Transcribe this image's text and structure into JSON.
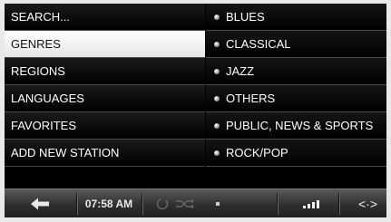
{
  "menu": {
    "items": [
      {
        "label": "SEARCH..."
      },
      {
        "label": "GENRES"
      },
      {
        "label": "REGIONS"
      },
      {
        "label": "LANGUAGES"
      },
      {
        "label": "FAVORITES"
      },
      {
        "label": "ADD NEW STATION"
      }
    ],
    "selected": "GENRES"
  },
  "genres": {
    "items": [
      {
        "label": "BLUES"
      },
      {
        "label": "CLASSICAL"
      },
      {
        "label": "JAZZ"
      },
      {
        "label": "OTHERS"
      },
      {
        "label": "PUBLIC, NEWS & SPORTS"
      },
      {
        "label": "ROCK/POP"
      }
    ]
  },
  "toolbar": {
    "time": "07:58 AM",
    "back_icon": "arrow-left-icon",
    "loading_icon": "spinner-icon",
    "shuffle_icon": "shuffle-icon",
    "stop_icon": "stop-icon",
    "signal_icon": "signal-strength-icon",
    "expand_icon": "expand-horizontal-icon",
    "expand_glyph": "<·>"
  },
  "colors": {
    "background": "#000000",
    "selected_row": "#ffffff",
    "toolbar": "#3a3a3a",
    "text": "#ffffff"
  }
}
